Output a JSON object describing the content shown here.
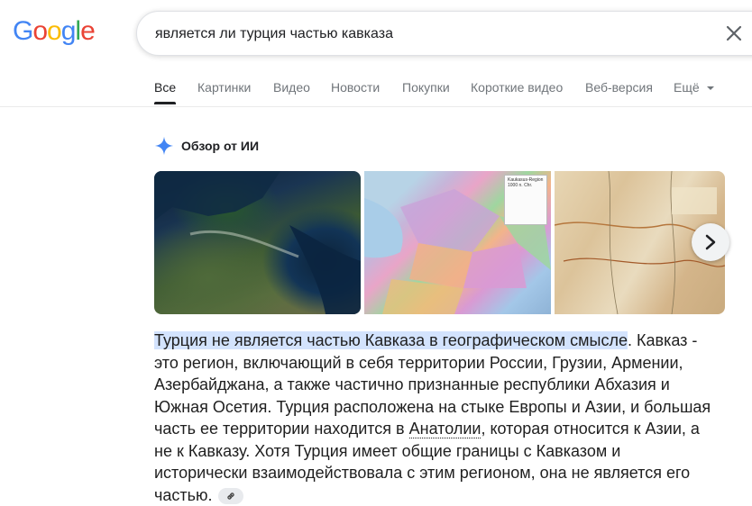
{
  "logo": {
    "letters": [
      "G",
      "o",
      "o",
      "g",
      "l",
      "e"
    ],
    "colors": [
      "#4285F4",
      "#EA4335",
      "#FBBC05",
      "#4285F4",
      "#34A853",
      "#EA4335"
    ]
  },
  "search": {
    "query": "является ли турция частью кавказа",
    "clear_icon": "close-icon"
  },
  "tabs": [
    {
      "label": "Все"
    },
    {
      "label": "Картинки"
    },
    {
      "label": "Видео"
    },
    {
      "label": "Новости"
    },
    {
      "label": "Покупки"
    },
    {
      "label": "Короткие видео"
    },
    {
      "label": "Веб-версия"
    },
    {
      "label": "Ещё"
    }
  ],
  "ai_overview": {
    "title": "Обзор от ИИ",
    "icon": "sparkle-icon",
    "images": [
      {
        "label": "caucasus-satellite-image"
      },
      {
        "label": "caucasus-region-map",
        "map_title": "Kaukasus-Region 1000 n. Chr."
      },
      {
        "label": "caucasus-old-map"
      }
    ],
    "answer": {
      "highlight": "Турция не является частью Кавказа в географическом смысле",
      "part1": ". Кавказ - это регион, включающий в себя территории России, Грузии, Армении, Азербайджана, а также частично признанные республики Абхазия и Южная Осетия. Турция расположена на стыке Европы и Азии, и большая часть ее территории находится в ",
      "link": "Анатолии",
      "part2": ", которая относится к Азии, а не к Кавказу. Хотя Турция имеет общие границы с Кавказом и исторически взаимодействовала с этим регионом, она не является его частью."
    }
  },
  "colors": {
    "accent_blue": "#4285F4",
    "highlight": "#d3e3fd"
  }
}
